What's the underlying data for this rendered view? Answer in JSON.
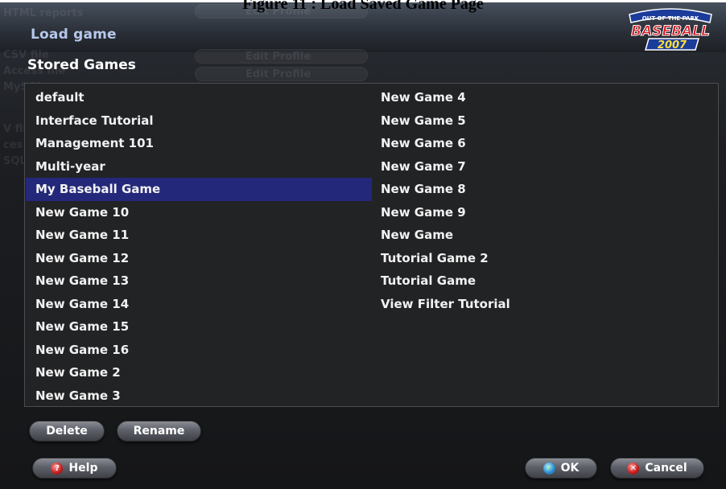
{
  "caption": "Figure 11 : Load Saved Game Page",
  "window": {
    "title": "Load game"
  },
  "logo": {
    "line1": "OUT OF THE PARK",
    "line2": "BASEBALL",
    "line3": "2007"
  },
  "stored_games": {
    "title": "Stored Games",
    "selected": "My Baseball Game",
    "left_column": [
      "default",
      "Interface Tutorial",
      "Management 101",
      "Multi-year",
      "My Baseball Game",
      "New Game 10",
      "New Game 11",
      "New Game 12",
      "New Game 13",
      "New Game 14",
      "New Game 15",
      "New Game 16",
      "New Game 2",
      "New Game 3"
    ],
    "right_column": [
      "New Game 4",
      "New Game 5",
      "New Game 6",
      "New Game 7",
      "New Game 8",
      "New Game 9",
      "New Game",
      "Tutorial Game 2",
      "Tutorial Game",
      "View Filter Tutorial"
    ]
  },
  "buttons": {
    "delete": "Delete",
    "rename": "Rename",
    "help": "Help",
    "ok": "OK",
    "cancel": "Cancel"
  },
  "background_ghost": {
    "labels": [
      "HTML reports",
      "CSV file",
      "Access file",
      "MySQL",
      "V file",
      "ces file",
      "SQL file"
    ],
    "edit_profile": "Edit Profile"
  },
  "colors": {
    "selection": "#23287a",
    "window_title": "#b6c8ea",
    "list_background": "#222325"
  }
}
